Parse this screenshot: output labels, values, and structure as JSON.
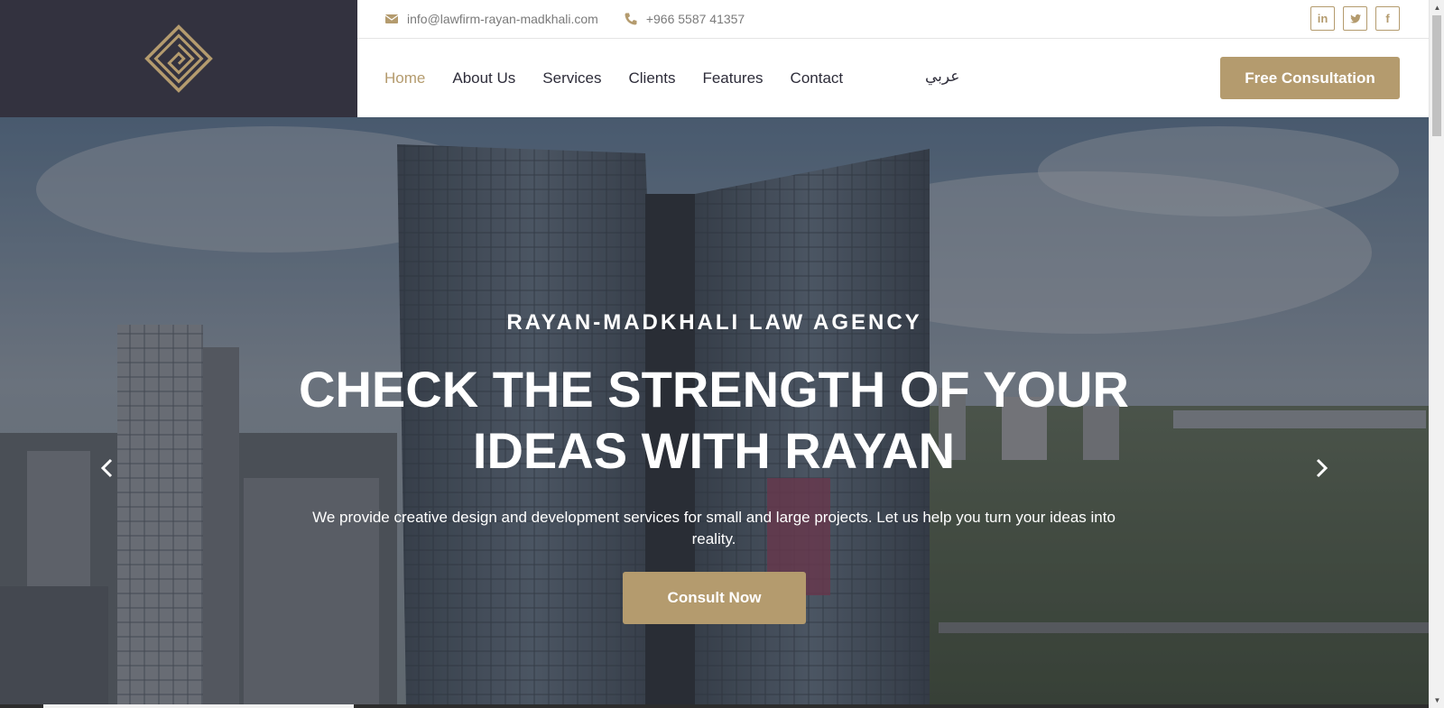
{
  "topbar": {
    "email": "info@lawfirm-rayan-madkhali.com",
    "phone": "+966 5587 41357",
    "email_icon": "envelope-icon",
    "phone_icon": "phone-icon",
    "socials": [
      {
        "name": "linkedin",
        "label": "in"
      },
      {
        "name": "twitter",
        "label": ""
      },
      {
        "name": "facebook",
        "label": "f"
      }
    ]
  },
  "nav": {
    "items": [
      {
        "label": "Home",
        "active": true
      },
      {
        "label": "About Us"
      },
      {
        "label": "Services"
      },
      {
        "label": "Clients"
      },
      {
        "label": "Features"
      },
      {
        "label": "Contact"
      }
    ],
    "language": "عربي",
    "cta_label": "Free Consultation"
  },
  "hero": {
    "subtitle": "RAYAN-MADKHALI LAW AGENCY",
    "title": "CHECK THE STRENGTH OF YOUR IDEAS WITH RAYAN",
    "description": "We provide creative design and development services for small and large projects. Let us help you turn your ideas into reality.",
    "button_label": "Consult Now"
  },
  "colors": {
    "accent": "#b49b6e",
    "dark": "#33323f",
    "nav_text": "#2e2d3a"
  }
}
